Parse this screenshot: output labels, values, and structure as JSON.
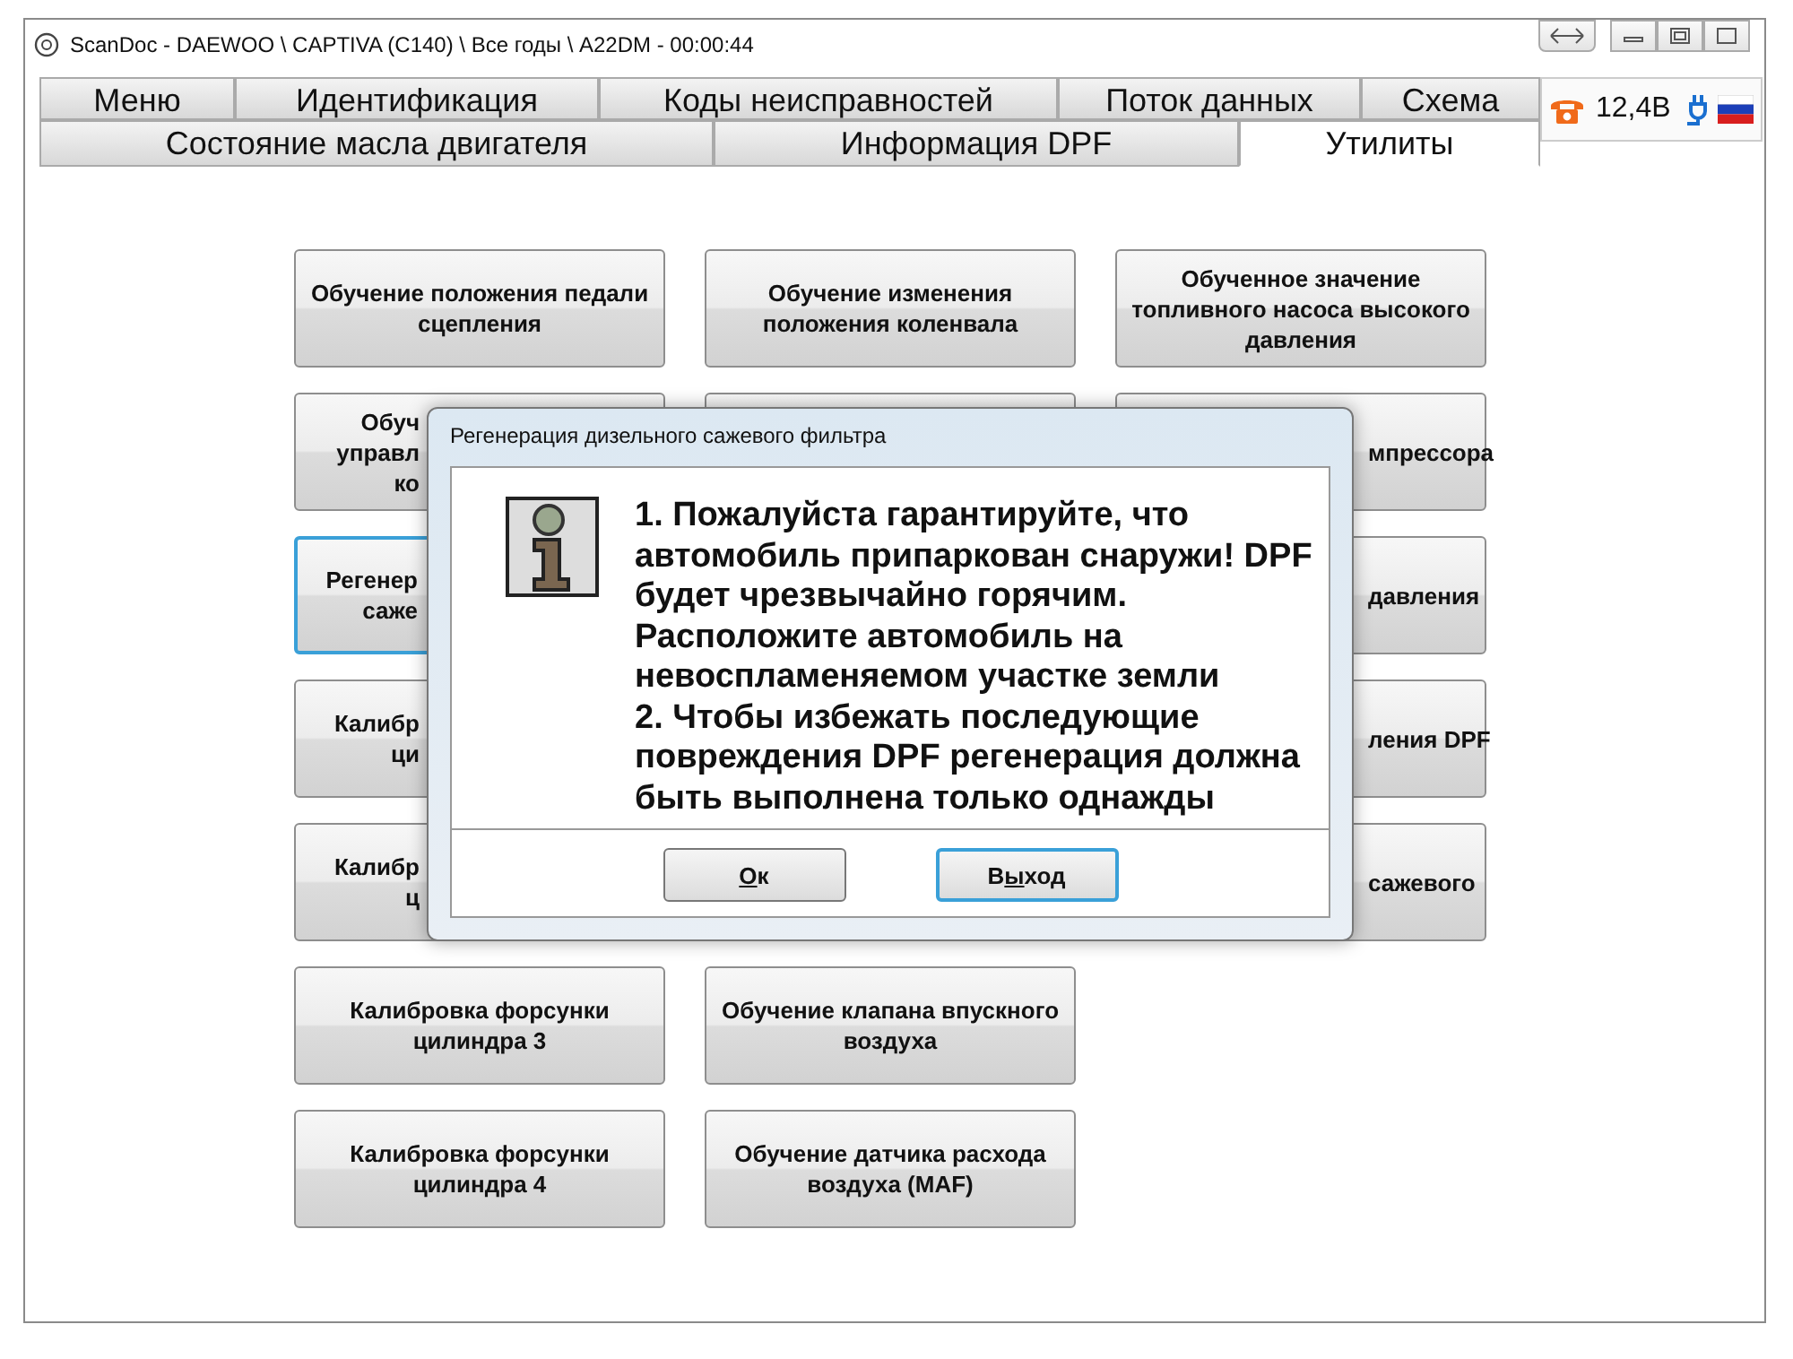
{
  "window": {
    "title": "ScanDoc - DAEWOO \\ CAPTIVA (C140) \\ Все годы \\ A22DM - 00:00:44"
  },
  "tabs_row_1": [
    {
      "label": "Меню",
      "selected": false
    },
    {
      "label": "Идентификация",
      "selected": false
    },
    {
      "label": "Коды неисправностей",
      "selected": false
    },
    {
      "label": "Поток данных",
      "selected": false
    },
    {
      "label": "Схема",
      "selected": false
    }
  ],
  "tabs_row_2": [
    {
      "label": "Состояние масла двигателя",
      "selected": false
    },
    {
      "label": "Информация DPF",
      "selected": false
    },
    {
      "label": "Утилиты",
      "selected": true
    }
  ],
  "status": {
    "voltage": "12,4В"
  },
  "utility_buttons": [
    [
      {
        "kind": "full",
        "lines": [
          "Обучение положения педали",
          "сцепления"
        ],
        "focused": false
      },
      {
        "kind": "full",
        "lines": [
          "Обучение изменения",
          "положения коленвала"
        ],
        "focused": false
      },
      {
        "kind": "full",
        "lines": [
          "Обученное значение",
          "топливного насоса высокого",
          "давления"
        ],
        "focused": false
      }
    ],
    [
      {
        "kind": "left-part",
        "lines": [
          "Обуч",
          "управл",
          "ко"
        ],
        "focused": false
      },
      {
        "kind": "covered"
      },
      {
        "kind": "right-part",
        "lines": [
          "мпрессора"
        ],
        "focused": false
      }
    ],
    [
      {
        "kind": "left-part",
        "lines": [
          "Регенер",
          "саже"
        ],
        "focused": true
      },
      {
        "kind": "right-part",
        "lines": [
          "давления"
        ],
        "focused": false
      }
    ],
    [
      {
        "kind": "left-part",
        "lines": [
          "Калибр",
          "ци"
        ],
        "focused": false
      },
      {
        "kind": "right-part",
        "lines": [
          "ления DPF"
        ],
        "focused": false
      }
    ],
    [
      {
        "kind": "left-part",
        "lines": [
          "Калибр",
          "ц"
        ],
        "focused": false
      },
      {
        "kind": "right-part",
        "lines": [
          "сажевого"
        ],
        "focused": false
      }
    ],
    [
      {
        "kind": "full",
        "lines": [
          "Калибровка форсунки",
          "цилиндра 3"
        ],
        "focused": false
      },
      {
        "kind": "full",
        "lines": [
          "Обучение клапана впускного",
          "воздуха"
        ],
        "focused": false
      }
    ],
    [
      {
        "kind": "full",
        "lines": [
          "Калибровка форсунки",
          "цилиндра 4"
        ],
        "focused": false
      },
      {
        "kind": "full",
        "lines": [
          "Обучение датчика расхода",
          "воздуха (MAF)"
        ],
        "focused": false
      }
    ]
  ],
  "dialog": {
    "title": "Регенерация дизельного сажевого фильтра",
    "message_lines": [
      "1. Пожалуйста гарантируйте, что",
      "автомобиль припаркован снаружи! DPF",
      "будет чрезвычайно горячим.",
      "Расположите автомобиль на",
      "невоспламеняемом участке земли",
      "2. Чтобы избежать последующие",
      "повреждения DPF регенерация должна",
      "быть выполнена только однажды"
    ],
    "buttons": [
      {
        "key": "О",
        "after": "к",
        "focused": false
      },
      {
        "before": "В",
        "key": "ы",
        "after": "ход",
        "focused": true
      }
    ]
  }
}
